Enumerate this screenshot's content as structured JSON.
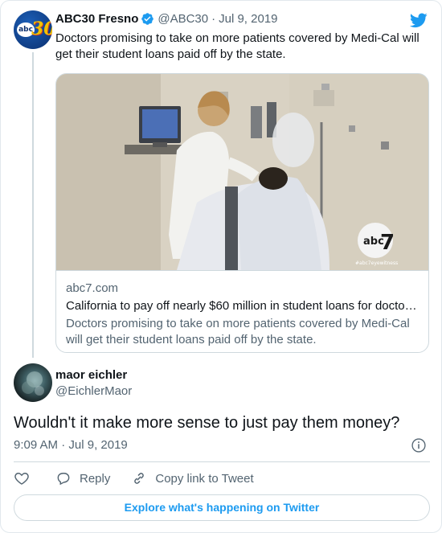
{
  "parent_tweet": {
    "author_name": "ABC30 Fresno",
    "handle": "@ABC30",
    "separator": "·",
    "date": "Jul 9, 2019",
    "avatar_icon": "abc30-logo-icon",
    "avatar_text_abc": "abc",
    "avatar_text_num": "30",
    "text": "Doctors promising to take on more patients covered by Medi-Cal will get their student loans paid off by the state.",
    "link_card": {
      "image_desc_icon": "hospital-photo",
      "image_watermark": "#abc7eyewitness",
      "domain": "abc7.com",
      "title": "California to pay off nearly $60 million in student loans for docto…",
      "description": "Doctors promising to take on more patients covered by Medi-Cal will get their student loans paid off by the state."
    }
  },
  "reply_tweet": {
    "author_name": "maor eichler",
    "handle": "@EichlerMaor",
    "text": "Wouldn't it make more sense to just pay them money?",
    "time": "9:09 AM",
    "separator": "·",
    "date": "Jul 9, 2019"
  },
  "actions": {
    "like_icon": "heart-icon",
    "reply_label": "Reply",
    "copy_label": "Copy link to Tweet"
  },
  "footer": {
    "explore_label": "Explore what's happening on Twitter"
  },
  "colors": {
    "brand_blue": "#1d9bf0",
    "text_primary": "#0f1419",
    "text_secondary": "#536471",
    "border": "#cfd9de"
  }
}
